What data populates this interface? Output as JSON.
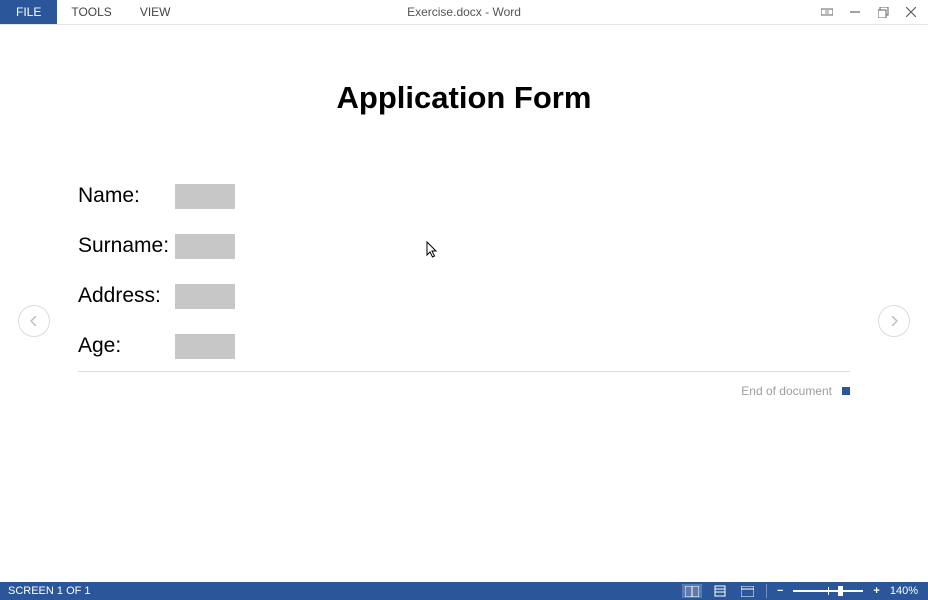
{
  "menu": {
    "file": "FILE",
    "tools": "TOOLS",
    "view": "VIEW"
  },
  "window_title": "Exercise.docx - Word",
  "document": {
    "title": "Application Form",
    "fields": {
      "name_label": "Name:",
      "surname_label": "Surname:",
      "address_label": "Address:",
      "age_label": "Age:"
    },
    "end_text": "End of document"
  },
  "statusbar": {
    "screen": "SCREEN 1 OF 1",
    "zoom": "140%"
  }
}
